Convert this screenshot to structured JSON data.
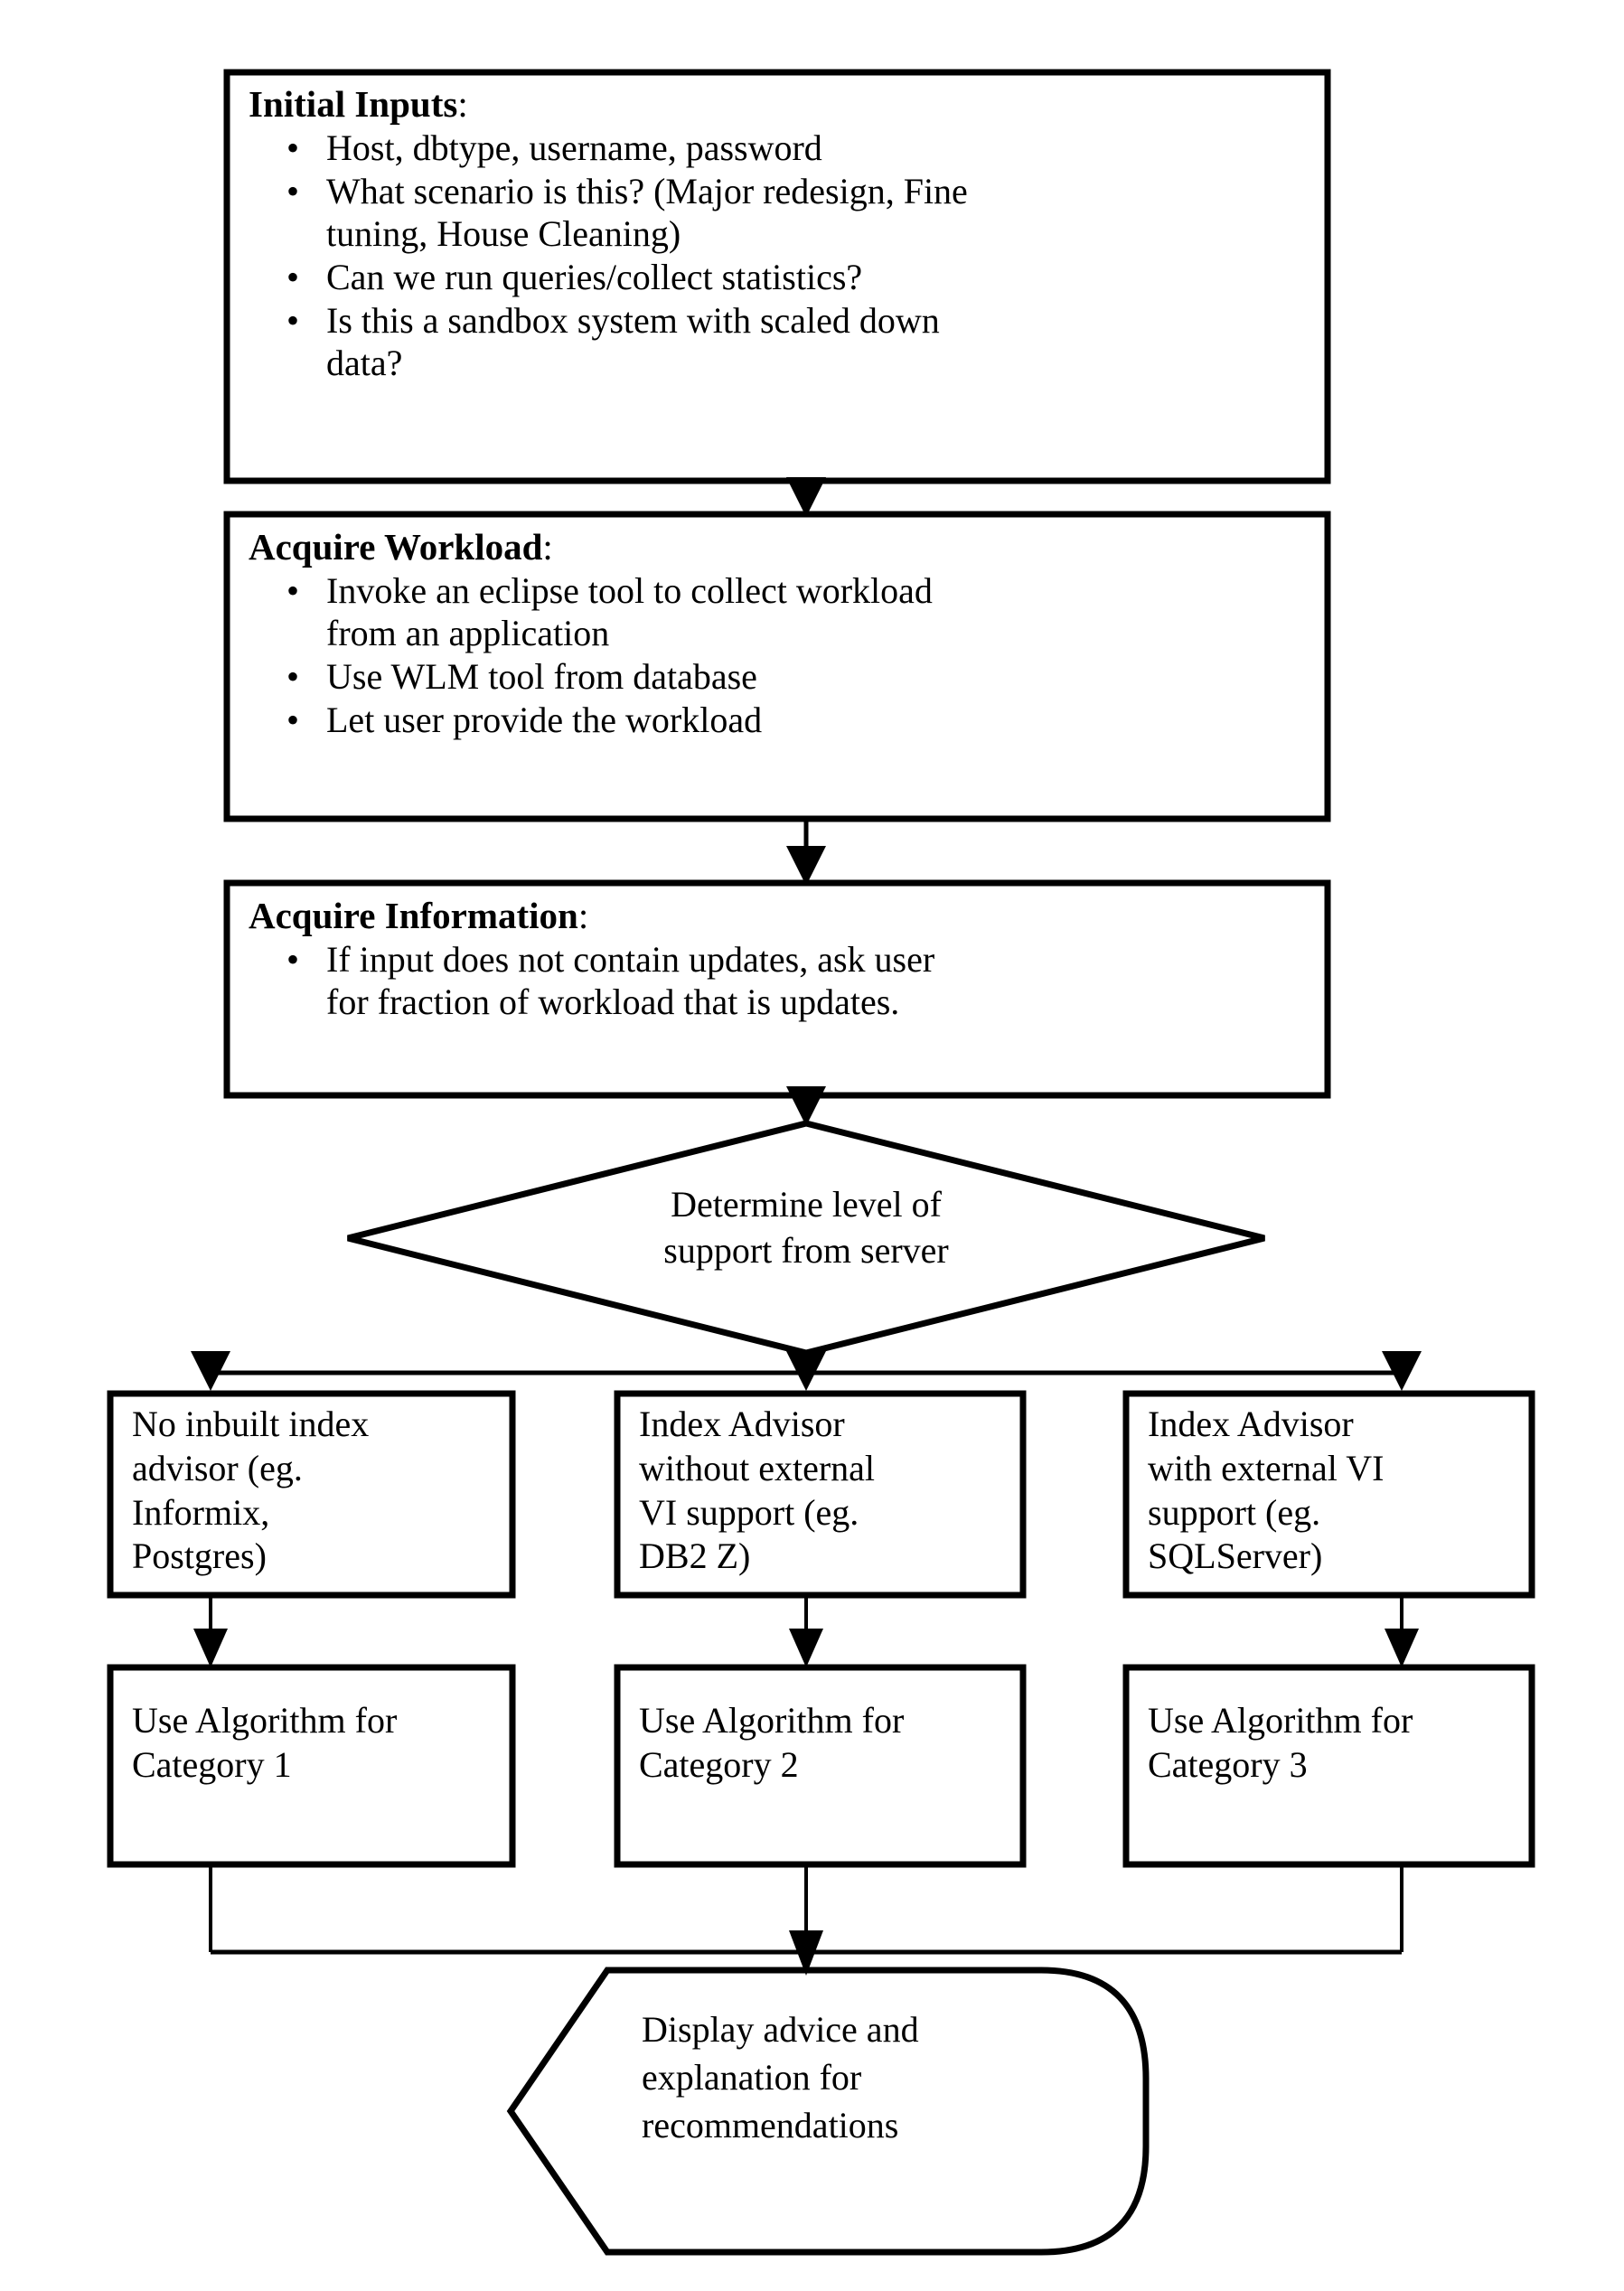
{
  "diagram": {
    "type": "flowchart",
    "title": "Index advisor workflow flowchart",
    "orientation": "top-to-bottom",
    "background_color": "#ffffff",
    "line_color": "#000000",
    "text_color": "#000000"
  },
  "nodes": {
    "initial_inputs": {
      "shape": "rectangle",
      "heading": "Initial Inputs",
      "heading_suffix": ":",
      "bullets": [
        "Host, dbtype, username, password",
        "What scenario is this? (Major redesign, Fine tuning, House Cleaning)",
        "Can we run queries/collect statistics?",
        "Is this a sandbox system with scaled down data?"
      ],
      "bullet_lines": [
        [
          "Host, dbtype, username, password"
        ],
        [
          "What scenario is this? (Major redesign, Fine",
          "tuning, House Cleaning)"
        ],
        [
          "Can we run queries/collect statistics?"
        ],
        [
          "Is this a sandbox system with scaled down",
          "data?"
        ]
      ]
    },
    "acquire_workload": {
      "shape": "rectangle",
      "heading": "Acquire Workload",
      "heading_suffix": ":",
      "bullets": [
        "Invoke an eclipse tool to collect workload from an application",
        "Use WLM tool from database",
        "Let user provide the workload"
      ],
      "bullet_lines": [
        [
          "Invoke an eclipse tool to collect workload",
          "from an application"
        ],
        [
          "Use WLM tool from database"
        ],
        [
          "Let user provide the workload"
        ]
      ]
    },
    "acquire_information": {
      "shape": "rectangle",
      "heading": "Acquire Information",
      "heading_suffix": ":",
      "bullets": [
        "If input does not contain updates, ask user for fraction of workload that is updates."
      ],
      "bullet_lines": [
        [
          "If input does not contain updates, ask user",
          "for fraction of workload that is updates."
        ]
      ]
    },
    "decision": {
      "shape": "diamond",
      "text": "Determine level of support from server",
      "lines": [
        "Determine level of",
        "support from server"
      ]
    },
    "branch_left": {
      "shape": "rectangle",
      "text": "No inbuilt index advisor (eg. Informix, Postgres)",
      "lines": [
        "No inbuilt index",
        "advisor (eg.",
        "Informix,",
        "Postgres)"
      ]
    },
    "branch_center": {
      "shape": "rectangle",
      "text": "Index Advisor without external VI support (eg. DB2 Z)",
      "lines": [
        "Index Advisor",
        "without external",
        "VI support (eg.",
        "DB2 Z)"
      ]
    },
    "branch_right": {
      "shape": "rectangle",
      "text": "Index Advisor with external VI support (eg. SQLServer)",
      "lines": [
        "Index Advisor",
        "with external VI",
        "support (eg.",
        "SQLServer)"
      ]
    },
    "algorithm_left": {
      "shape": "rectangle",
      "text": "Use Algorithm for Category 1",
      "lines": [
        "Use Algorithm for",
        "Category 1"
      ]
    },
    "algorithm_center": {
      "shape": "rectangle",
      "text": "Use Algorithm for Category 2",
      "lines": [
        "Use Algorithm for",
        "Category 2"
      ]
    },
    "algorithm_right": {
      "shape": "rectangle",
      "text": "Use Algorithm for Category 3",
      "lines": [
        "Use Algorithm for",
        "Category 3"
      ]
    },
    "display_output": {
      "shape": "pentagon-arrow",
      "text": "Display advice and explanation for recommendations",
      "lines": [
        "Display advice and",
        "explanation for",
        "recommendations"
      ]
    }
  },
  "edges": [
    {
      "from": "initial_inputs",
      "to": "acquire_workload",
      "style": "arrow"
    },
    {
      "from": "acquire_workload",
      "to": "acquire_information",
      "style": "arrow"
    },
    {
      "from": "acquire_information",
      "to": "decision",
      "style": "arrow"
    },
    {
      "from": "decision",
      "to": "branch_left",
      "style": "arrow"
    },
    {
      "from": "decision",
      "to": "branch_center",
      "style": "arrow"
    },
    {
      "from": "decision",
      "to": "branch_right",
      "style": "arrow"
    },
    {
      "from": "branch_left",
      "to": "algorithm_left",
      "style": "arrow"
    },
    {
      "from": "branch_center",
      "to": "algorithm_center",
      "style": "arrow"
    },
    {
      "from": "branch_right",
      "to": "algorithm_right",
      "style": "arrow"
    },
    {
      "from": "algorithm_left",
      "to": "display_output",
      "style": "merge"
    },
    {
      "from": "algorithm_center",
      "to": "display_output",
      "style": "merge"
    },
    {
      "from": "algorithm_right",
      "to": "display_output",
      "style": "merge"
    }
  ]
}
